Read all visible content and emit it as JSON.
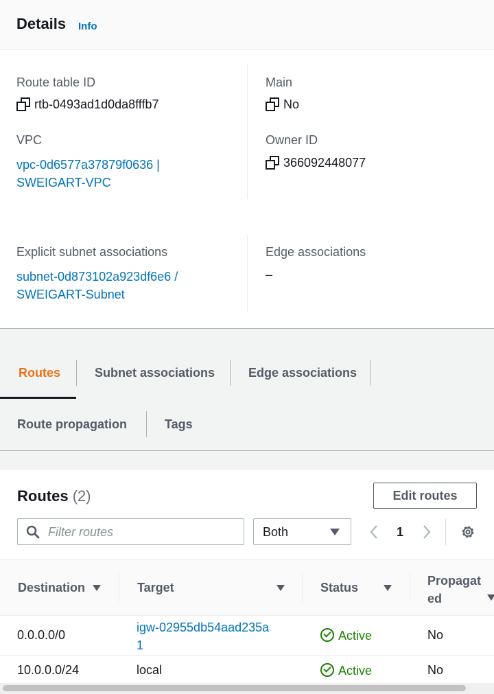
{
  "details": {
    "title": "Details",
    "info": "Info",
    "route_table_id": {
      "label": "Route table ID",
      "value": "rtb-0493ad1d0da8fffb7"
    },
    "main": {
      "label": "Main",
      "value": "No"
    },
    "vpc": {
      "label": "VPC",
      "line1": "vpc-0d6577a37879f0636 |",
      "line2": "SWEIGART-VPC"
    },
    "owner": {
      "label": "Owner ID",
      "value": "366092448077"
    },
    "subnets": {
      "label": "Explicit subnet associations",
      "line1": "subnet-0d873102a923df6e6 /",
      "line2": "SWEIGART-Subnet"
    },
    "edge": {
      "label": "Edge associations",
      "value": "–"
    }
  },
  "tabs": [
    "Routes",
    "Subnet associations",
    "Edge associations",
    "Route propagation",
    "Tags"
  ],
  "routes": {
    "title": "Routes",
    "count": "(2)",
    "edit_button": "Edit routes",
    "filter_placeholder": "Filter routes",
    "filter_select": "Both",
    "page": "1",
    "columns": [
      "Destination",
      "Target",
      "Status",
      "Propagat",
      "ed"
    ],
    "rows": [
      {
        "destination": "0.0.0.0/0",
        "target_line1": "igw-02955db54aad235a",
        "target_line2": "1",
        "status": "Active",
        "propagated": "No"
      },
      {
        "destination": "10.0.0.0/24",
        "target_line1": "local",
        "target_line2": "",
        "status": "Active",
        "propagated": "No"
      }
    ]
  },
  "colors": {
    "link": "#0073bb",
    "active_tab": "#ec7211",
    "status_ok": "#1d8102"
  }
}
